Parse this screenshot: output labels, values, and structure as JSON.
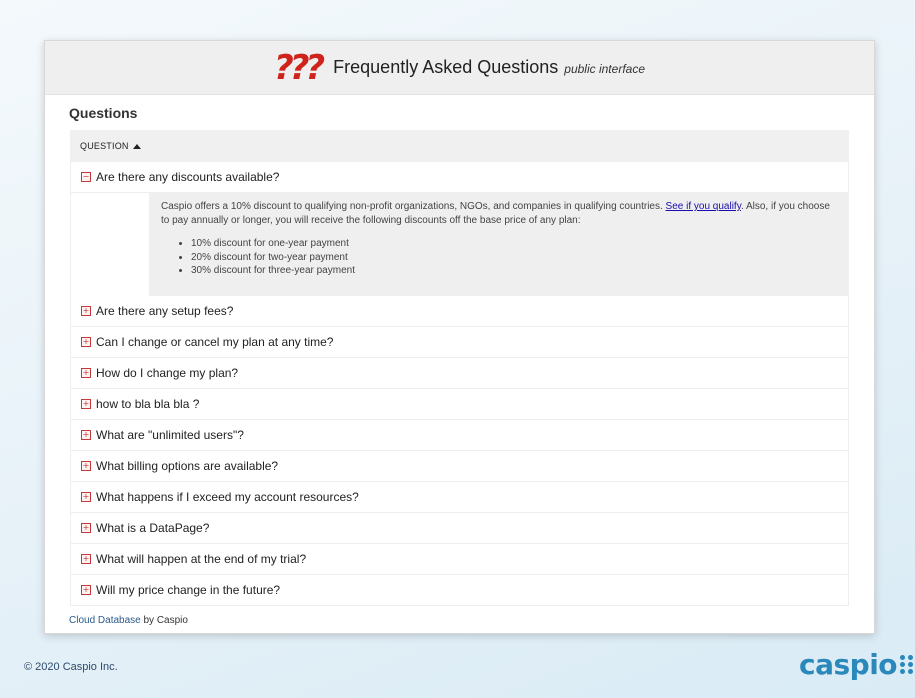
{
  "header": {
    "logo_glyph": "???",
    "title": "Frequently Asked Questions",
    "subtitle": "public interface"
  },
  "section_title": "Questions",
  "table": {
    "column_header": "QUESTION",
    "expanded": {
      "question": "Are there any discounts available?",
      "answer_text_1": "Caspio offers a 10% discount to qualifying non-profit organizations, NGOs, and companies in qualifying countries. ",
      "answer_link": "See if you qualify",
      "answer_text_2": ". Also, if you choose to pay annually or longer, you will receive the following discounts off the base price of any plan:",
      "bullets": [
        "10% discount for one-year payment",
        "20% discount for two-year payment",
        "30% discount for three-year payment"
      ]
    },
    "rows": [
      "Are there any setup fees?",
      "Can I change or cancel my plan at any time?",
      "How do I change my plan?",
      "how to bla bla bla ?",
      "What are \"unlimited users\"?",
      "What billing options are available?",
      "What happens if I exceed my account resources?",
      "What is a DataPage?",
      "What will happen at the end of my trial?",
      "Will my price change in the future?"
    ]
  },
  "footer": {
    "link": "Cloud Database",
    "text": " by Caspio"
  },
  "copyright": "© 2020 Caspio Inc.",
  "brand_logo": "caspio",
  "colors": {
    "accent_red": "#d0231b",
    "brand_blue": "#2a88bb",
    "link_blue": "#1a0dab"
  },
  "icons": {
    "expanded": "minus-box-icon",
    "collapsed": "plus-box-icon",
    "sort": "sort-ascending-icon"
  }
}
